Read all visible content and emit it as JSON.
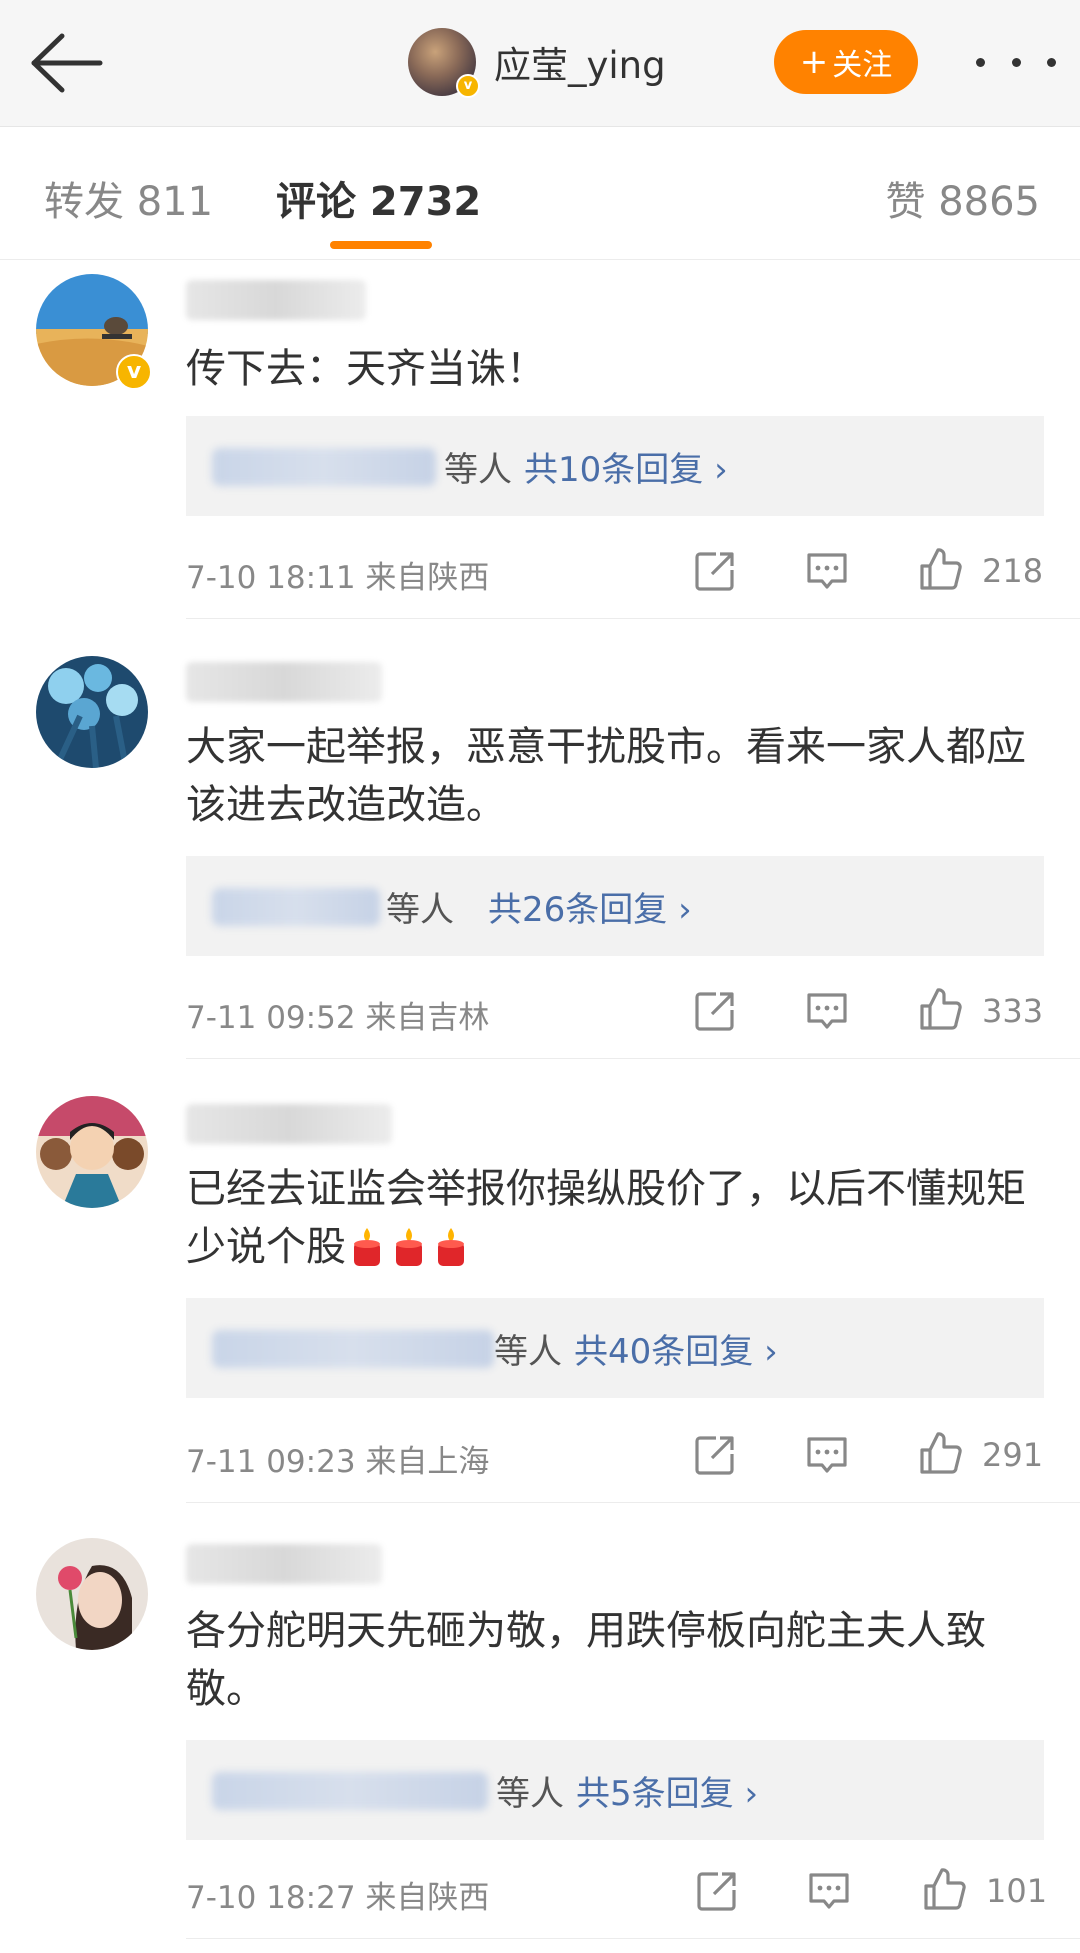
{
  "header": {
    "username": "应莹_ying",
    "follow_label": "关注",
    "back_icon": "back-arrow-icon",
    "more_icon": "more-icon"
  },
  "tabs": {
    "repost": "转发 811",
    "comment": "评论 2732",
    "likes": "赞 8865"
  },
  "colors": {
    "accent": "#ff8200",
    "link": "#4a6ea8",
    "badge": "#f7b500"
  },
  "comments": [
    {
      "text": "传下去：天齐当诛！",
      "reply_others": "等人",
      "reply_count": "共10条回复 ›",
      "time": "7-10 18:11",
      "location": "来自陕西",
      "likes": "218"
    },
    {
      "text": "大家一起举报，恶意干扰股市。看来一家人都应该进去改造改造。",
      "reply_others": "等人",
      "reply_count": "共26条回复 ›",
      "time": "7-11 09:52",
      "location": "来自吉林",
      "likes": "333"
    },
    {
      "text": "已经去证监会举报你操纵股价了，以后不懂规矩少说个股",
      "reply_others": "等人",
      "reply_count": "共40条回复 ›",
      "time": "7-11 09:23",
      "location": "来自上海",
      "likes": "291"
    },
    {
      "text": "各分舵明天先砸为敬，用跌停板向舵主夫人致敬。",
      "reply_others": "等人",
      "reply_count": "共5条回复 ›",
      "time": "7-10 18:27",
      "location": "来自陕西",
      "likes": "101"
    }
  ]
}
